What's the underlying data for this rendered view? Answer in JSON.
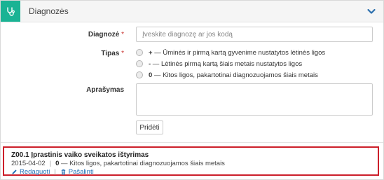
{
  "colors": {
    "accent": "#1ab394",
    "link": "#1f6fb5",
    "highlight_border": "#cc1f2a"
  },
  "header": {
    "title": "Diagnozės",
    "icon": "stethoscope-icon",
    "toggle_icon": "chevron-down-icon"
  },
  "form": {
    "diagnosis": {
      "label": "Diagnozė",
      "required_mark": "*",
      "placeholder": "Įveskite diagnozę ar jos kodą",
      "value": ""
    },
    "type": {
      "label": "Tipas",
      "required_mark": "*",
      "options": [
        {
          "code": "+",
          "text": " — Ūminės ir pirmą kartą gyvenime nustatytos lėtinės ligos"
        },
        {
          "code": "-",
          "text": " — Lėtinės pirmą kartą šiais metais nustatytos ligos"
        },
        {
          "code": "0",
          "text": " — Kitos ligos, pakartotinai diagnozuojamos šiais metais"
        }
      ]
    },
    "description": {
      "label": "Aprašymas",
      "value": ""
    },
    "add_button": "Pridėti"
  },
  "entries": [
    {
      "title": "Z00.1 Įprastinis vaiko sveikatos ištyrimas",
      "date": "2015-04-02",
      "separator": "|",
      "type_code": "0",
      "type_text": " — Kitos ligos, pakartotinai diagnozuojamos šiais metais",
      "edit_label": "Redaguoti",
      "remove_label": "Pašalinti"
    }
  ]
}
